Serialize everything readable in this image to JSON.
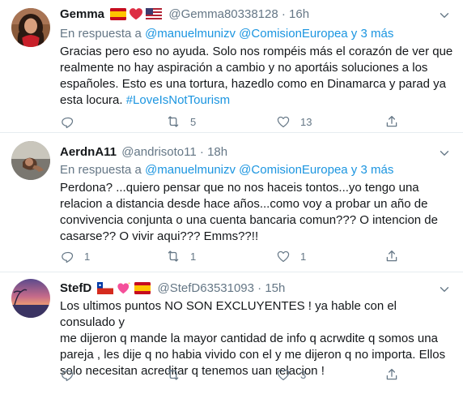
{
  "tweets": [
    {
      "name": "Gemma",
      "handle": "@Gemma80338128",
      "dot": "·",
      "time": "16h",
      "reply_prefix": "En respuesta a",
      "reply_users": "@manuelmunizv @ComisionEuropea y 3 más",
      "lines": [
        "Gracias pero eso no ayuda. Solo nos rompéis más el corazón de ver que",
        "realmente no hay aspiración a cambio y no aportáis soluciones a los",
        "españoles. Esto es una tortura, hazedlo como en Dinamarca y parad ya",
        "esta locura."
      ],
      "hashtag": "#LoveIsNotTourism",
      "reply_count": "",
      "retweet_count": "5",
      "like_count": "13"
    },
    {
      "name": "AerdnA11",
      "handle": "@andrisoto11",
      "dot": "·",
      "time": "18h",
      "reply_prefix": "En respuesta a",
      "reply_users": "@manuelmunizv @ComisionEuropea y 3 más",
      "lines": [
        "Perdona? ...quiero pensar que no nos haceis tontos...yo tengo una",
        "relacion a distancia desde hace años...como voy a probar un año de",
        "convivencia conjunta o una cuenta bancaria comun??? O intencion de",
        "casarse?? O vivir aqui??? Emms??!!"
      ],
      "reply_count": "1",
      "retweet_count": "1",
      "like_count": "1"
    },
    {
      "name": "StefD",
      "handle": "@StefD63531093",
      "dot": "·",
      "time": "15h",
      "lines": [
        "Los ultimos puntos NO SON EXCLUYENTES ! ya hable con el consulado y",
        "me dijeron q mande la mayor cantidad de info q acrwdite q somos una",
        "pareja , les dije q no habia vivido con el y me dijeron q no importa. Ellos",
        "solo necesitan acreditar q tenemos uan relacion !"
      ],
      "reply_count": "",
      "retweet_count": "",
      "like_count": "3"
    }
  ],
  "colors": {
    "text": "#14171a",
    "muted": "#657786",
    "link": "#1b95e0",
    "border": "#e6ecf0"
  }
}
